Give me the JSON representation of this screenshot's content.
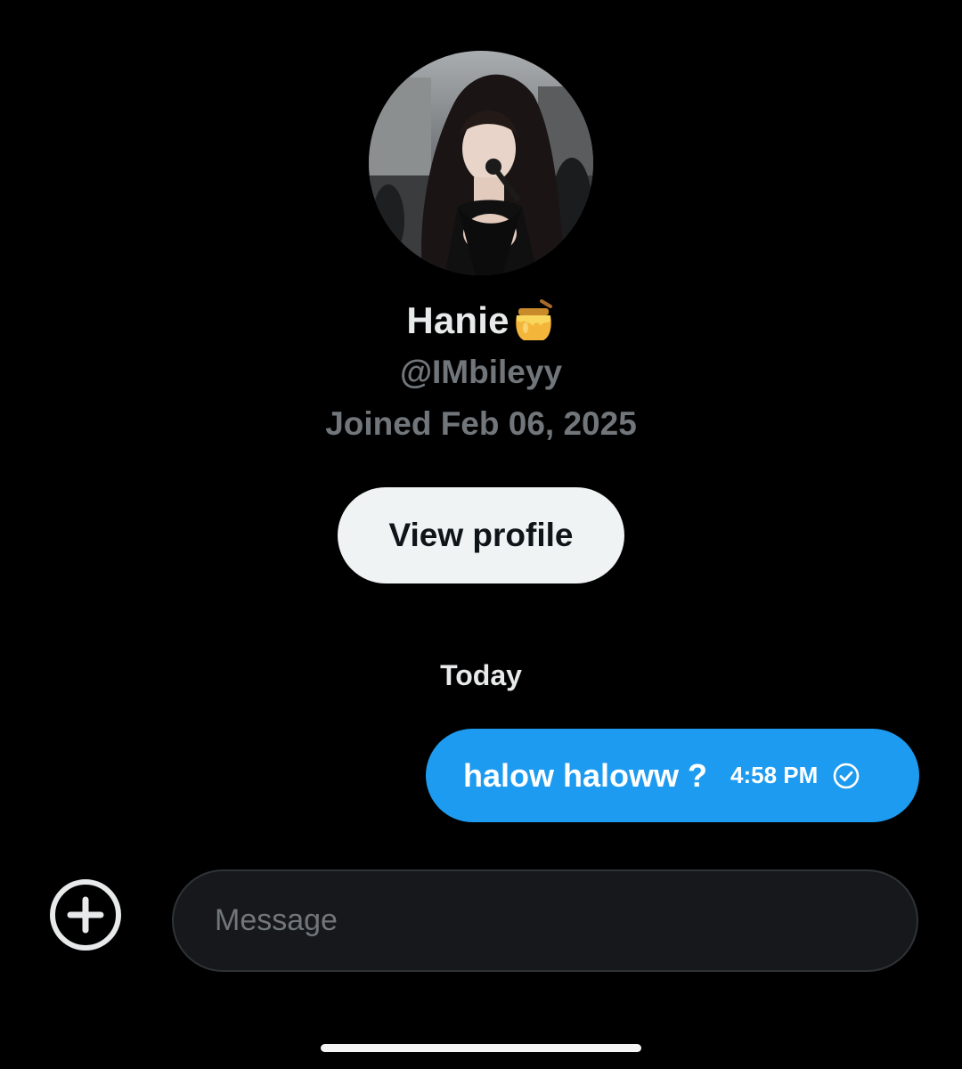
{
  "profile": {
    "display_name": "Hanie",
    "name_emoji": "honey-pot-icon",
    "handle": "@IMbileyy",
    "joined": "Joined Feb 06, 2025",
    "view_profile_label": "View profile"
  },
  "conversation": {
    "date_divider": "Today",
    "messages": [
      {
        "text": "halow haloww ?",
        "time": "4:58 PM",
        "status_icon": "sent-check-icon",
        "outgoing": true
      }
    ]
  },
  "composer": {
    "add_icon": "plus-circle-icon",
    "placeholder": "Message"
  },
  "colors": {
    "background": "#000000",
    "bubble": "#1d9bf0",
    "muted_text": "#71767b",
    "button_bg": "#eff3f4"
  }
}
